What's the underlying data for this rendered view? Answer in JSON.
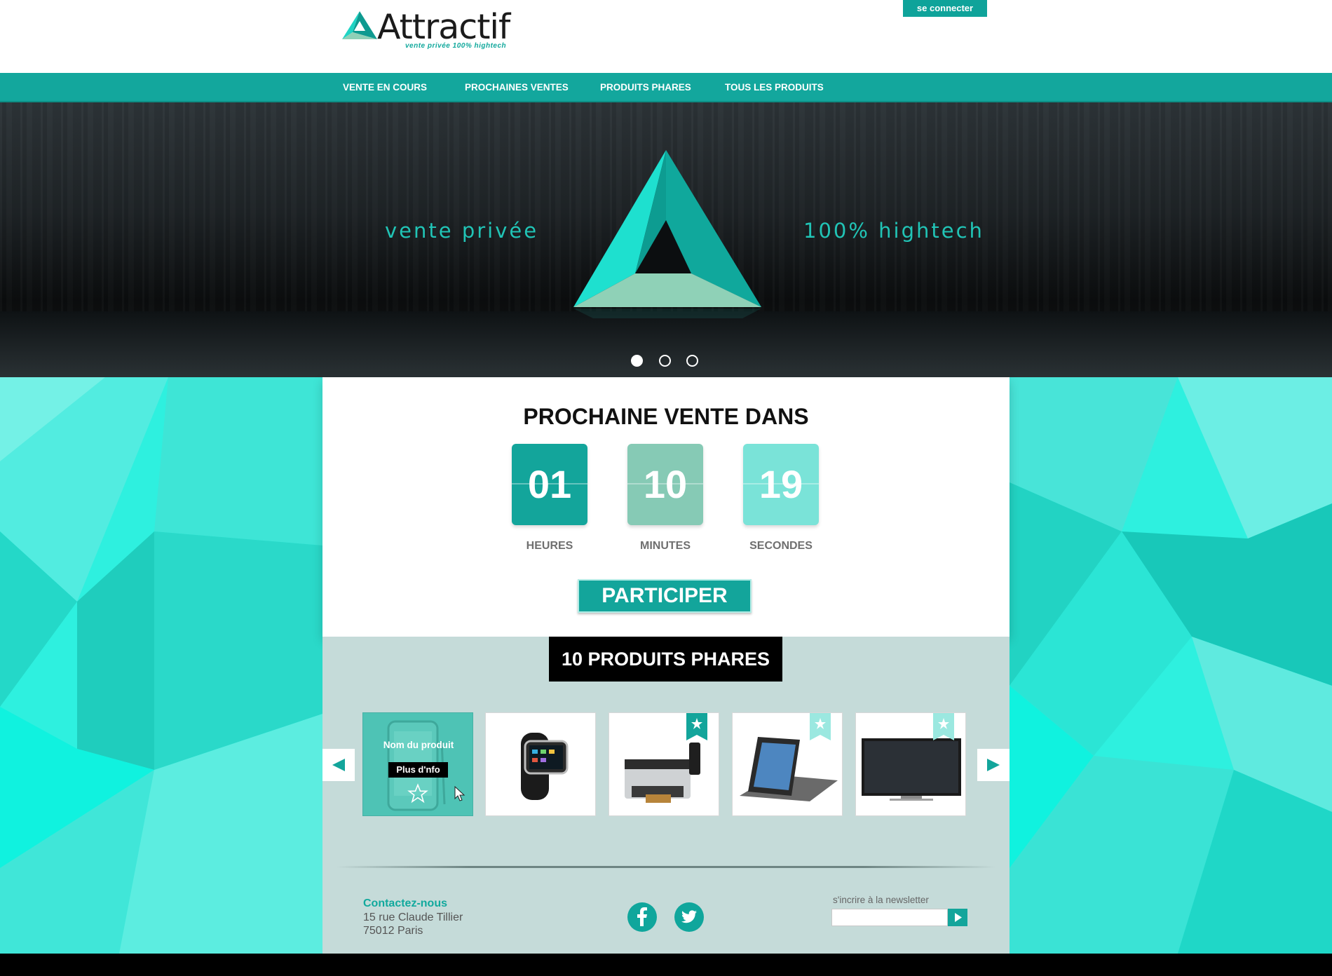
{
  "header": {
    "logo_text": "Attractif",
    "logo_tagline": "vente privée 100% hightech",
    "login_label": "se connecter"
  },
  "nav": {
    "items": [
      {
        "label": "VENTE EN COURS"
      },
      {
        "label": "PROCHAINES VENTES"
      },
      {
        "label": "PRODUITS PHARES"
      },
      {
        "label": "TOUS LES PRODUITS"
      }
    ]
  },
  "hero": {
    "left_text": "vente privée",
    "right_text": "100% hightech",
    "slides": 3,
    "active_slide": 1
  },
  "countdown": {
    "title": "PROCHAINE VENTE DANS",
    "units": [
      {
        "value": "01",
        "label": "HEURES",
        "color": "#13a59b"
      },
      {
        "value": "10",
        "label": "MINUTES",
        "color": "#86cab5"
      },
      {
        "value": "19",
        "label": "SECONDES",
        "color": "#7ae3d8"
      }
    ],
    "cta_label": "PARTICIPER"
  },
  "products": {
    "title": "10 PRODUITS PHARES",
    "hover_name": "Nom du produit",
    "hover_button": "Plus d'nfo",
    "items": [
      {
        "name": "phone",
        "highlighted": true,
        "ribbon": "none"
      },
      {
        "name": "smartwatch",
        "highlighted": false,
        "ribbon": "none"
      },
      {
        "name": "printer",
        "highlighted": false,
        "ribbon": "dark"
      },
      {
        "name": "tablet",
        "highlighted": false,
        "ribbon": "light"
      },
      {
        "name": "tv",
        "highlighted": false,
        "ribbon": "light"
      }
    ]
  },
  "footer": {
    "contact_title": "Contactez-nous",
    "address_line1": "15 rue Claude Tillier",
    "address_line2": "75012 Paris",
    "social": [
      "facebook-icon",
      "twitter-icon"
    ],
    "newsletter_label": "s'incrire à la newsletter",
    "newsletter_placeholder": ""
  },
  "colors": {
    "accent": "#13a59b",
    "background": "#2ef0df",
    "products_bg": "#c5dbd9"
  }
}
